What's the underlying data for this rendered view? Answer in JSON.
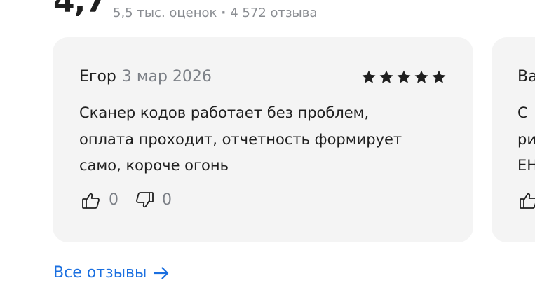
{
  "summary": {
    "rating": "4,7",
    "ratings_count": "5,5 тыс. оценок",
    "separator": "·",
    "reviews_count": "4 572 отзыва"
  },
  "reviews": [
    {
      "author": "Егор",
      "date": "3 мар 2026",
      "stars": 5,
      "text_lines": [
        "Сканер кодов работает без проблем,",
        "оплата проходит, отчетность формирует",
        "само, короче огонь"
      ],
      "likes": "0",
      "dislikes": "0"
    },
    {
      "author": "Ва",
      "text_lines": [
        "С",
        "ри",
        "ЕН"
      ]
    }
  ],
  "all_reviews_label": "Все отзывы",
  "icons": {
    "star": "star-icon",
    "like": "thumbs-up-icon",
    "dislike": "thumbs-down-icon",
    "arrow": "arrow-right-icon"
  },
  "colors": {
    "card_bg": "#f4f4f4",
    "link": "#1a6fe0",
    "muted_text": "#7c8087",
    "star": "#1f1f1f"
  }
}
